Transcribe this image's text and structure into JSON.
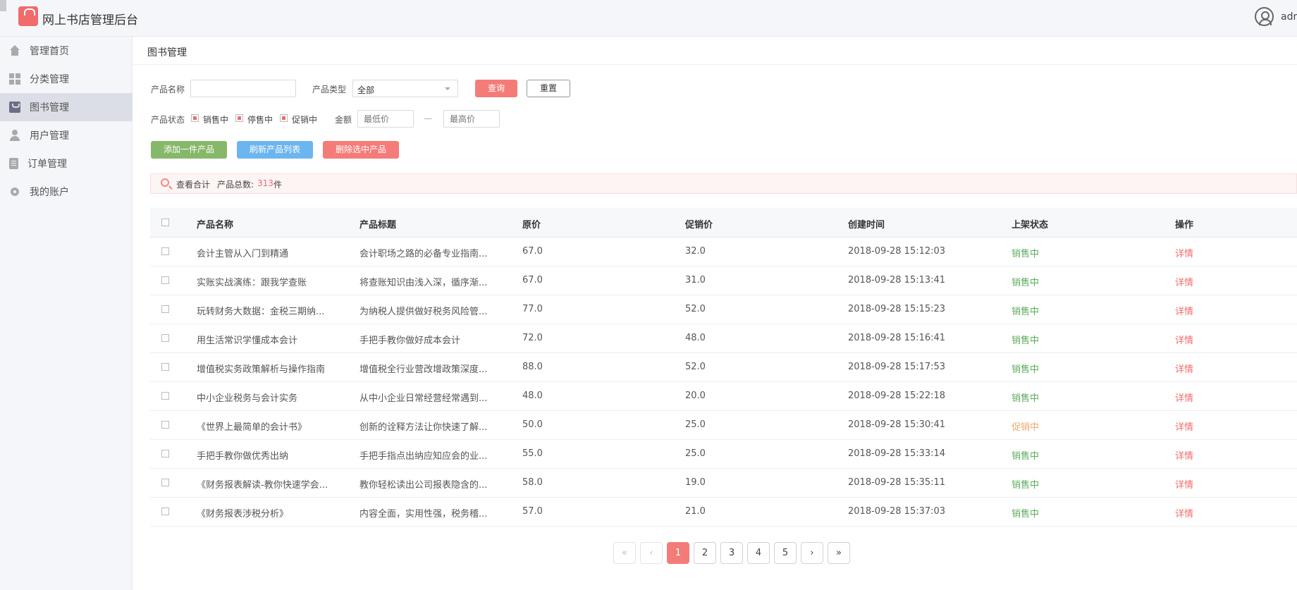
{
  "app": {
    "title": "网上书店管理后台",
    "user": "admin"
  },
  "sidebar": {
    "items": [
      {
        "label": "管理首页",
        "icon": "home-icon"
      },
      {
        "label": "分类管理",
        "icon": "grid-icon"
      },
      {
        "label": "图书管理",
        "icon": "book-icon",
        "active": true
      },
      {
        "label": "用户管理",
        "icon": "user-icon"
      },
      {
        "label": "订单管理",
        "icon": "clipboard-icon"
      },
      {
        "label": "我的账户",
        "icon": "gear-icon"
      }
    ]
  },
  "page": {
    "title": "图书管理"
  },
  "filters": {
    "name_label": "产品名称",
    "name_value": "",
    "type_label": "产品类型",
    "type_value": "全部",
    "query_button": "查询",
    "reset_button": "重置",
    "status_label": "产品状态",
    "status_options": [
      {
        "label": "销售中",
        "checked": true
      },
      {
        "label": "停售中",
        "checked": true
      },
      {
        "label": "促销中",
        "checked": true
      }
    ],
    "price_label": "金额",
    "min_price_placeholder": "最低价",
    "price_separator": "—",
    "max_price_placeholder": "最高价"
  },
  "actions": {
    "add": "添加一件产品",
    "refresh": "刷新产品列表",
    "delete": "删除选中产品"
  },
  "summary": {
    "view_label": "查看合计",
    "total_label": "产品总数:",
    "total_count": "313",
    "unit": "件"
  },
  "table": {
    "headers": [
      "产品名称",
      "产品标题",
      "原价",
      "促销价",
      "创建时间",
      "上架状态",
      "操作"
    ],
    "rows": [
      {
        "name": "会计主管从入门到精通",
        "title": "会计职场之路的必备专业指南...",
        "price": "67.0",
        "promo": "32.0",
        "created": "2018-09-28 15:12:03",
        "status": "销售中",
        "status_type": "on",
        "op": "详情"
      },
      {
        "name": "实账实战演练：跟我学查账",
        "title": "将查账知识由浅入深，循序渐...",
        "price": "67.0",
        "promo": "31.0",
        "created": "2018-09-28 15:13:41",
        "status": "销售中",
        "status_type": "on",
        "op": "详情"
      },
      {
        "name": "玩转财务大数据：金税三期纳...",
        "title": "为纳税人提供做好税务风险管...",
        "price": "77.0",
        "promo": "52.0",
        "created": "2018-09-28 15:15:23",
        "status": "销售中",
        "status_type": "on",
        "op": "详情"
      },
      {
        "name": "用生活常识学懂成本会计",
        "title": "手把手教你做好成本会计",
        "price": "72.0",
        "promo": "48.0",
        "created": "2018-09-28 15:16:41",
        "status": "销售中",
        "status_type": "on",
        "op": "详情"
      },
      {
        "name": "增值税实务政策解析与操作指南",
        "title": "增值税全行业营改增政策深度...",
        "price": "88.0",
        "promo": "52.0",
        "created": "2018-09-28 15:17:53",
        "status": "销售中",
        "status_type": "on",
        "op": "详情"
      },
      {
        "name": "中小企业税务与会计实务",
        "title": "从中小企业日常经营经常遇到...",
        "price": "48.0",
        "promo": "20.0",
        "created": "2018-09-28 15:22:18",
        "status": "销售中",
        "status_type": "on",
        "op": "详情"
      },
      {
        "name": "《世界上最简单的会计书》",
        "title": "创新的诠释方法让你快速了解...",
        "price": "50.0",
        "promo": "25.0",
        "created": "2018-09-28 15:30:41",
        "status": "促销中",
        "status_type": "promo",
        "op": "详情"
      },
      {
        "name": "手把手教你做优秀出纳",
        "title": "手把手指点出纳应知应会的业...",
        "price": "55.0",
        "promo": "25.0",
        "created": "2018-09-28 15:33:14",
        "status": "销售中",
        "status_type": "on",
        "op": "详情"
      },
      {
        "name": "《财务报表解读-教你快速学会...",
        "title": "教你轻松读出公司报表隐含的...",
        "price": "58.0",
        "promo": "19.0",
        "created": "2018-09-28 15:35:11",
        "status": "销售中",
        "status_type": "on",
        "op": "详情"
      },
      {
        "name": "《财务报表涉税分析》",
        "title": "内容全面，实用性强，税务稽...",
        "price": "57.0",
        "promo": "21.0",
        "created": "2018-09-28 15:37:03",
        "status": "销售中",
        "status_type": "on",
        "op": "详情"
      }
    ]
  },
  "pagination": {
    "first": "«",
    "prev": "‹",
    "pages": [
      "1",
      "2",
      "3",
      "4",
      "5"
    ],
    "current": "1",
    "next": "›",
    "last": "»"
  },
  "colors": {
    "accent": "#f47c78",
    "status_on": "#5cab5c",
    "status_promo": "#f0a868"
  }
}
